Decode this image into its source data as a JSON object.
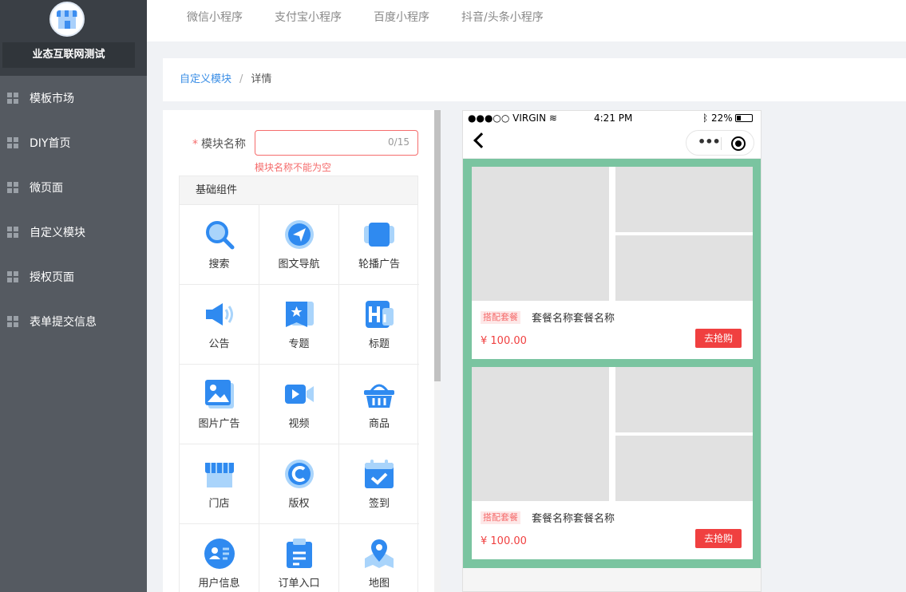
{
  "sidebar": {
    "brand": "业态互联网测试",
    "items": [
      {
        "label": "模板市场"
      },
      {
        "label": "DIY首页"
      },
      {
        "label": "微页面"
      },
      {
        "label": "自定义模块"
      },
      {
        "label": "授权页面"
      },
      {
        "label": "表单提交信息"
      }
    ]
  },
  "tabs": [
    {
      "label": "微信小程序"
    },
    {
      "label": "支付宝小程序"
    },
    {
      "label": "百度小程序"
    },
    {
      "label": "抖音/头条小程序"
    }
  ],
  "breadcrumb": {
    "parent": "自定义模块",
    "separator": "/",
    "current": "详情"
  },
  "form": {
    "required_mark": "*",
    "name_label": "模块名称",
    "name_value": "",
    "name_count": "0/15",
    "name_error": "模块名称不能为空"
  },
  "components": {
    "title": "基础组件",
    "items": [
      {
        "label": "搜索",
        "icon": "search-icon"
      },
      {
        "label": "图文导航",
        "icon": "navigation-icon"
      },
      {
        "label": "轮播广告",
        "icon": "carousel-icon"
      },
      {
        "label": "公告",
        "icon": "megaphone-icon"
      },
      {
        "label": "专题",
        "icon": "topic-icon"
      },
      {
        "label": "标题",
        "icon": "heading-icon"
      },
      {
        "label": "图片广告",
        "icon": "image-icon"
      },
      {
        "label": "视频",
        "icon": "video-icon"
      },
      {
        "label": "商品",
        "icon": "basket-icon"
      },
      {
        "label": "门店",
        "icon": "store-icon"
      },
      {
        "label": "版权",
        "icon": "copyright-icon"
      },
      {
        "label": "签到",
        "icon": "calendar-check-icon"
      },
      {
        "label": "用户信息",
        "icon": "user-card-icon"
      },
      {
        "label": "订单入口",
        "icon": "clipboard-icon"
      },
      {
        "label": "地图",
        "icon": "map-pin-icon"
      }
    ]
  },
  "phone": {
    "carrier": "●●●○○ VIRGIN",
    "time": "4:21 PM",
    "battery": "22%",
    "cards": [
      {
        "tag": "搭配套餐",
        "name": "套餐名称套餐名称",
        "price": "¥ 100.00",
        "button": "去抢购"
      },
      {
        "tag": "搭配套餐",
        "name": "套餐名称套餐名称",
        "price": "¥ 100.00",
        "button": "去抢购"
      }
    ]
  },
  "colors": {
    "accent": "#3a8ee6",
    "error": "#f56c6c",
    "preview_bg": "#7ac4a0",
    "buy": "#f04040"
  }
}
